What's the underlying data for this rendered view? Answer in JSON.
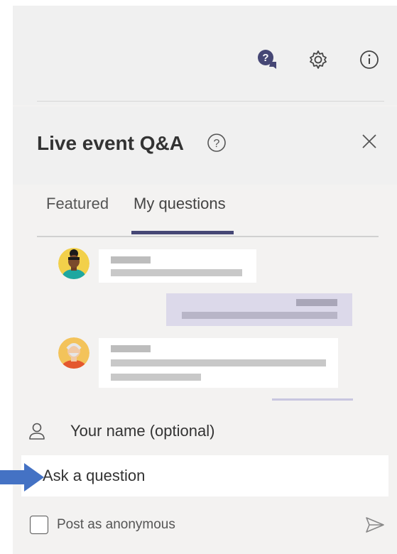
{
  "header": {
    "title": "Live event Q&A"
  },
  "top_icons": [
    "qa-chat-icon",
    "gear-icon",
    "info-icon"
  ],
  "tabs": [
    {
      "label": "Featured",
      "selected": false
    },
    {
      "label": "My questions",
      "selected": true
    }
  ],
  "form": {
    "name_label": "Your name (optional)",
    "ask_placeholder": "Ask a question",
    "anonymous_label": "Post as anonymous"
  },
  "colors": {
    "accent": "#464775",
    "panel_bg": "#f3f2f1",
    "self_bubble": "#dcd9ea",
    "pointer_arrow": "#4472c4"
  }
}
